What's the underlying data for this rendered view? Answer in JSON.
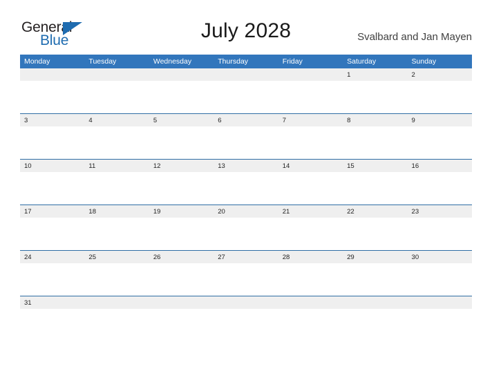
{
  "brand": {
    "name_part1": "General",
    "name_part2": "Blue",
    "color_dark": "#231f20",
    "color_blue": "#1f6cb0"
  },
  "header": {
    "title": "July 2028",
    "region": "Svalbard and Jan Mayen"
  },
  "theme": {
    "header_blue": "#3276bc",
    "divider_blue": "#2e6da4",
    "date_band_gray": "#efefef",
    "page_background": "#ffffff"
  },
  "calendar": {
    "month": "July",
    "year": "2028",
    "week_start": "Monday",
    "weekday_headers": [
      "Monday",
      "Tuesday",
      "Wednesday",
      "Thursday",
      "Friday",
      "Saturday",
      "Sunday"
    ],
    "weeks": [
      [
        "",
        "",
        "",
        "",
        "",
        "1",
        "2"
      ],
      [
        "3",
        "4",
        "5",
        "6",
        "7",
        "8",
        "9"
      ],
      [
        "10",
        "11",
        "12",
        "13",
        "14",
        "15",
        "16"
      ],
      [
        "17",
        "18",
        "19",
        "20",
        "21",
        "22",
        "23"
      ],
      [
        "24",
        "25",
        "26",
        "27",
        "28",
        "29",
        "30"
      ],
      [
        "31",
        "",
        "",
        "",
        "",
        "",
        ""
      ]
    ]
  }
}
